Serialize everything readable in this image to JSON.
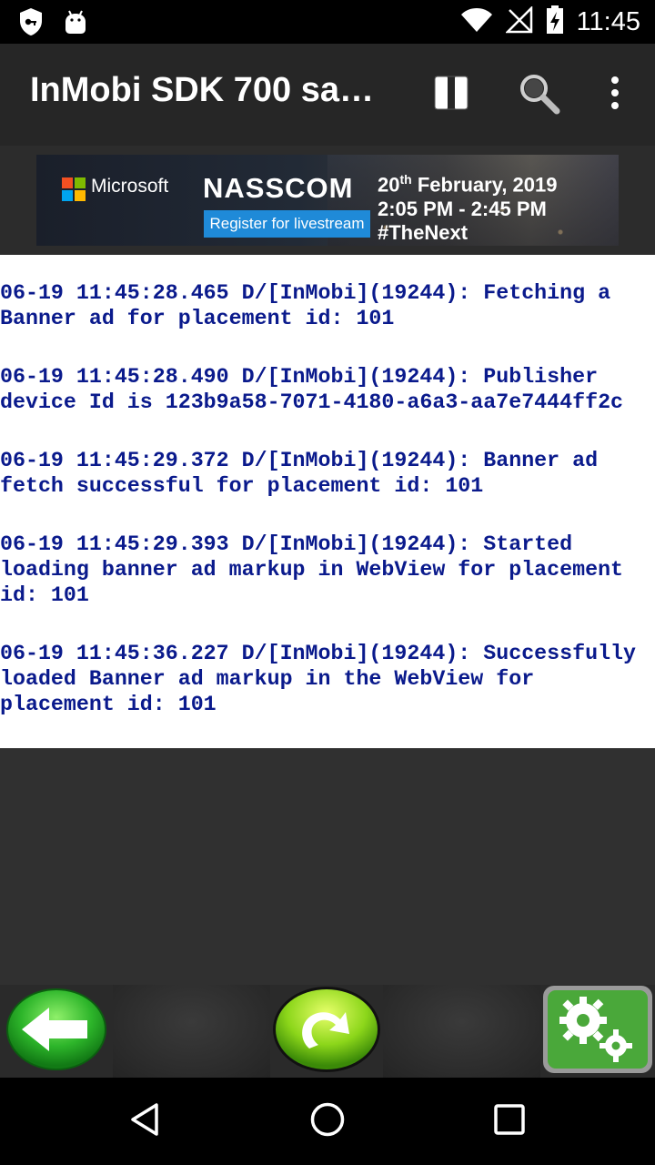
{
  "status_bar": {
    "time": "11:45",
    "left_icons": [
      "vpn-key-shield-icon",
      "android-debug-icon"
    ],
    "right_icons": [
      "wifi-icon",
      "no-signal-icon",
      "battery-charging-icon"
    ]
  },
  "toolbar": {
    "title": "InMobi SDK 700 sa…",
    "actions": [
      "pause-icon",
      "search-icon",
      "overflow-menu-icon"
    ]
  },
  "banner": {
    "brand": "Microsoft",
    "event": "NASSCOM",
    "register_label": "Register for livestream",
    "date": "20th February, 2019",
    "date_day": "20",
    "date_suffix": "th",
    "date_rest": " February, 2019",
    "time_range": "2:05 PM - 2:45 PM",
    "hashtag": "#TheNext"
  },
  "log": [
    "06-19 11:45:28.465 D/[InMobi](19244): Fetching a\nBanner ad for placement id: 101",
    "06-19 11:45:28.490 D/[InMobi](19244): Publisher\ndevice Id is 123b9a58-7071-4180-a6a3-aa7e7444ff2c",
    "06-19 11:45:29.372 D/[InMobi](19244): Banner ad\nfetch successful for placement id: 101",
    "06-19 11:45:29.393 D/[InMobi](19244): Started\nloading banner ad markup in WebView for placement\nid: 101",
    "06-19 11:45:36.227 D/[InMobi](19244): Successfully\nloaded Banner ad markup in the WebView for\nplacement id: 101"
  ],
  "action_bar": {
    "buttons": [
      "back-arrow-icon",
      "refresh-icon",
      "settings-gears-icon"
    ]
  },
  "nav_bar": {
    "buttons": [
      "back-triangle-icon",
      "home-circle-icon",
      "recents-square-icon"
    ]
  },
  "colors": {
    "log_text": "#0a1a8c",
    "toolbar_bg": "#262626",
    "register_blue": "#1f8ad8"
  }
}
